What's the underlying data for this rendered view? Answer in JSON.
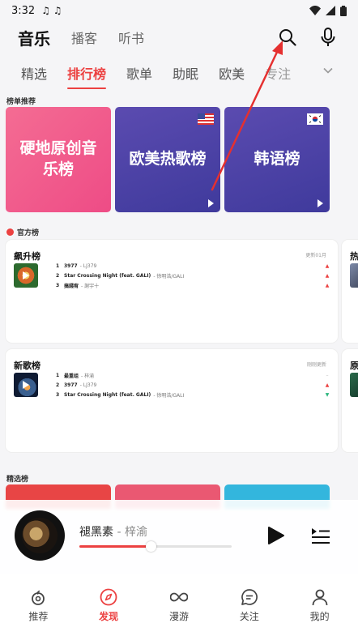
{
  "status": {
    "time": "3:32",
    "music_icons": "♫ ♫"
  },
  "top_nav": {
    "tabs": [
      "音乐",
      "播客",
      "听书"
    ],
    "active": 0
  },
  "categories": {
    "items": [
      "精选",
      "排行榜",
      "歌单",
      "助眠",
      "欧美",
      "专注"
    ],
    "active": 1
  },
  "rank_section": {
    "label": "榜单推荐",
    "cards": [
      {
        "title": "硬地原创音乐榜"
      },
      {
        "title": "欧美热歌榜"
      },
      {
        "title": "韩语榜"
      }
    ]
  },
  "official_section": {
    "label": "官方榜",
    "charts": [
      {
        "title": "飙升榜",
        "more": "更新01月",
        "songs": [
          {
            "idx": "1",
            "name": "3977",
            "artist": "- LJ379",
            "trend": "up"
          },
          {
            "idx": "2",
            "name": "Star Crossing Night (feat. GALI)",
            "artist": "- 徐明浩/GALI",
            "trend": "up"
          },
          {
            "idx": "3",
            "name": "搞錢宥",
            "artist": "- 謝宇十",
            "trend": "up"
          }
        ]
      },
      {
        "title": "新歌榜",
        "more": "刚刚更新",
        "songs": [
          {
            "idx": "1",
            "name": "最重组",
            "artist": "- 梓渝",
            "trend": "flat"
          },
          {
            "idx": "2",
            "name": "3977",
            "artist": "- LJ379",
            "trend": "up"
          },
          {
            "idx": "3",
            "name": "Star Crossing Night (feat. GALI)",
            "artist": "- 徐明浩/GALI",
            "trend": "down"
          }
        ]
      }
    ],
    "side_titles": [
      "热",
      "原"
    ]
  },
  "picks_section": {
    "label": "精选榜"
  },
  "player": {
    "song": "褪黑素",
    "separator": " - ",
    "artist": "梓渝",
    "progress": 0.47
  },
  "bottom_nav": {
    "items": [
      {
        "label": "推荐",
        "icon": "recommend-icon"
      },
      {
        "label": "发现",
        "icon": "compass-icon"
      },
      {
        "label": "漫游",
        "icon": "infinity-icon"
      },
      {
        "label": "关注",
        "icon": "chat-icon"
      },
      {
        "label": "我的",
        "icon": "user-icon"
      }
    ],
    "active": 1
  },
  "colors": {
    "accent": "#ec4141"
  }
}
